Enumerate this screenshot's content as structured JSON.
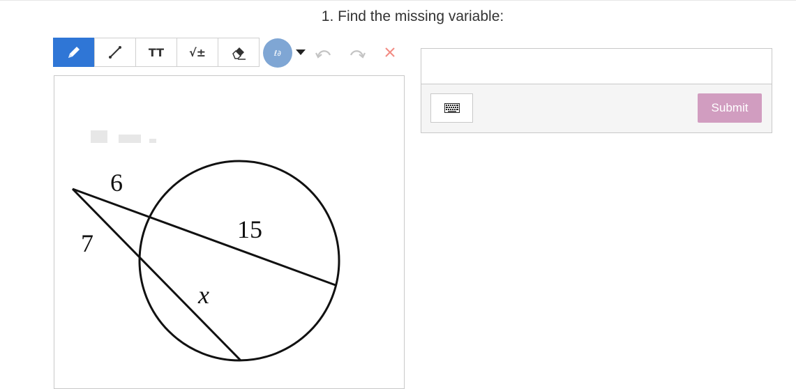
{
  "question": {
    "title": "1. Find the missing variable:"
  },
  "toolbar": {
    "tools": [
      {
        "name": "pencil-tool",
        "label": ""
      },
      {
        "name": "line-tool",
        "label": ""
      },
      {
        "name": "text-tool",
        "label": "TT"
      },
      {
        "name": "math-tool",
        "label": "√±"
      },
      {
        "name": "eraser-tool",
        "label": ""
      }
    ],
    "color_badge": "ℓ∂",
    "icons": [
      "pencil-icon",
      "line-icon",
      "eraser-icon",
      "dropdown-icon",
      "undo-icon",
      "redo-icon",
      "clear-icon"
    ]
  },
  "figure": {
    "labels": {
      "top_segment": "6",
      "left_segment": "7",
      "chord": "15",
      "variable": "x"
    }
  },
  "answer": {
    "input_value": "",
    "submit_label": "Submit"
  },
  "colors": {
    "active_tool": "#2f76d6",
    "color_swatch": "#7fa6d4",
    "submit": "#d19dc0",
    "clear": "#f28b82"
  }
}
